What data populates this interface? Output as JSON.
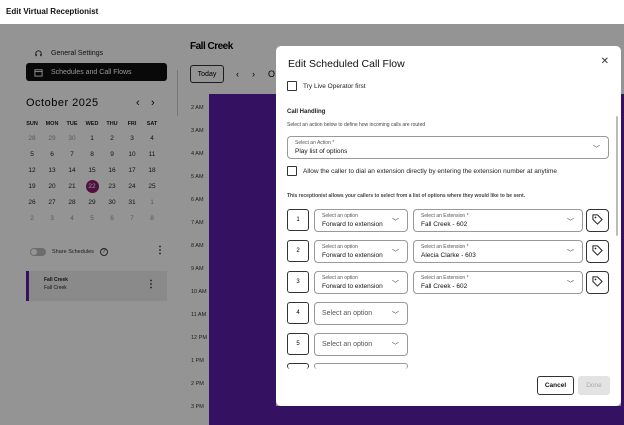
{
  "app": {
    "title": "Edit Virtual Receptionist"
  },
  "sidebar": {
    "items": [
      {
        "label": "General Settings",
        "icon": "headset-icon"
      },
      {
        "label": "Schedules and Call Flows",
        "icon": "calendar-icon",
        "active": true
      }
    ],
    "calendar": {
      "month_label": "October 2025",
      "days_of_week": [
        "SUN",
        "MON",
        "TUE",
        "WED",
        "THU",
        "FRI",
        "SAT"
      ],
      "weeks": [
        [
          "28",
          "29",
          "30",
          "1",
          "2",
          "3",
          "4"
        ],
        [
          "5",
          "6",
          "7",
          "8",
          "9",
          "10",
          "11"
        ],
        [
          "12",
          "13",
          "14",
          "15",
          "16",
          "17",
          "18"
        ],
        [
          "19",
          "20",
          "21",
          "22",
          "23",
          "24",
          "25"
        ],
        [
          "26",
          "27",
          "28",
          "29",
          "30",
          "31",
          "1"
        ],
        [
          "2",
          "3",
          "4",
          "5",
          "6",
          "7",
          "8"
        ]
      ],
      "today": "22"
    },
    "share_label": "Share Schedules",
    "schedule_card": {
      "title": "Fall Creek",
      "subtitle": "Fall Creek"
    }
  },
  "calendar_view": {
    "title": "Fall Creek",
    "today_label": "Today",
    "times": [
      "2 AM",
      "3 AM",
      "4 AM",
      "5 AM",
      "6 AM",
      "7 AM",
      "8 AM",
      "9 AM",
      "10 AM",
      "11 AM",
      "12 PM",
      "1 PM",
      "2 PM",
      "3 PM"
    ],
    "event_color": "#5a1ea8"
  },
  "modal": {
    "title": "Edit Scheduled Call Flow",
    "live_operator_label": "Try Live Operator first",
    "call_handling_heading": "Call Handling",
    "call_handling_desc": "Select an action below to define how incoming calls are routed",
    "action_select": {
      "label": "Select an Action *",
      "value": "Play list of options"
    },
    "allow_dial_label": "Allow the caller to dial an extension directly by entering the extension number at anytime",
    "options_desc": "This receptionist allows your callers to select from a list of options where they would like to be sent.",
    "option_rows": [
      {
        "num": "1",
        "option_label": "Select an option",
        "option_value": "Forward to extension",
        "ext_label": "Select an Extension *",
        "ext_value": "Fall Creek - 602"
      },
      {
        "num": "2",
        "option_label": "Select an option",
        "option_value": "Forward to extension",
        "ext_label": "Select an Extension *",
        "ext_value": "Alecia Clarke - 603"
      },
      {
        "num": "3",
        "option_label": "Select an option",
        "option_value": "Forward to extension",
        "ext_label": "Select an Extension *",
        "ext_value": "Fall Creek - 602"
      }
    ],
    "empty_rows": [
      {
        "num": "4",
        "placeholder": "Select an option"
      },
      {
        "num": "5",
        "placeholder": "Select an option"
      }
    ],
    "cancel_label": "Cancel",
    "done_label": "Done"
  }
}
